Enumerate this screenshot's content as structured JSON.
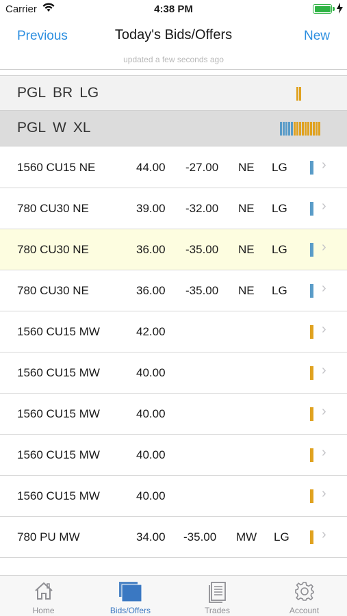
{
  "status_bar": {
    "carrier": "Carrier",
    "time": "4:38 PM"
  },
  "nav": {
    "left_label": "Previous",
    "title": "Today's Bids/Offers",
    "right_label": "New",
    "subtitle": "updated a few seconds ago"
  },
  "groups": [
    {
      "parts": [
        "PGL",
        "BR",
        "LG"
      ],
      "bars": [
        "yellow",
        "yellow"
      ]
    },
    {
      "parts": [
        "PGL",
        "W",
        "XL"
      ],
      "bars": [
        "blue",
        "blue",
        "blue",
        "blue",
        "blue",
        "yellow",
        "yellow",
        "yellow",
        "yellow",
        "yellow",
        "yellow",
        "yellow",
        "yellow",
        "yellow",
        "yellow"
      ]
    }
  ],
  "rows": [
    {
      "name": "1560 CU15 NE",
      "price": "44.00",
      "diff": "-27.00",
      "loc": "NE",
      "grp": "LG",
      "indicator": "blue",
      "highlight": false
    },
    {
      "name": "780 CU30 NE",
      "price": "39.00",
      "diff": "-32.00",
      "loc": "NE",
      "grp": "LG",
      "indicator": "blue",
      "highlight": false
    },
    {
      "name": "780 CU30 NE",
      "price": "36.00",
      "diff": "-35.00",
      "loc": "NE",
      "grp": "LG",
      "indicator": "blue",
      "highlight": true
    },
    {
      "name": "780 CU30 NE",
      "price": "36.00",
      "diff": "-35.00",
      "loc": "NE",
      "grp": "LG",
      "indicator": "blue",
      "highlight": false
    },
    {
      "name": "1560 CU15 MW",
      "price": "42.00",
      "diff": "",
      "loc": "",
      "grp": "",
      "indicator": "yellow",
      "highlight": false
    },
    {
      "name": "1560 CU15 MW",
      "price": "40.00",
      "diff": "",
      "loc": "",
      "grp": "",
      "indicator": "yellow",
      "highlight": false
    },
    {
      "name": "1560 CU15 MW",
      "price": "40.00",
      "diff": "",
      "loc": "",
      "grp": "",
      "indicator": "yellow",
      "highlight": false
    },
    {
      "name": "1560 CU15 MW",
      "price": "40.00",
      "diff": "",
      "loc": "",
      "grp": "",
      "indicator": "yellow",
      "highlight": false
    },
    {
      "name": "1560 CU15 MW",
      "price": "40.00",
      "diff": "",
      "loc": "",
      "grp": "",
      "indicator": "yellow",
      "highlight": false
    },
    {
      "name": "780 PU MW",
      "price": "34.00",
      "diff": "-35.00",
      "loc": "MW",
      "grp": "LG",
      "indicator": "yellow",
      "highlight": false
    }
  ],
  "tabs": [
    {
      "label": "Home",
      "icon": "home-icon",
      "active": false
    },
    {
      "label": "Bids/Offers",
      "icon": "stack-icon",
      "active": true
    },
    {
      "label": "Trades",
      "icon": "document-icon",
      "active": false
    },
    {
      "label": "Account",
      "icon": "gear-icon",
      "active": false
    }
  ],
  "colors": {
    "accent": "#2b8ee0",
    "indicator_blue": "#5a9cc8",
    "indicator_yellow": "#e0a220",
    "highlight_row": "#fdfde0"
  }
}
